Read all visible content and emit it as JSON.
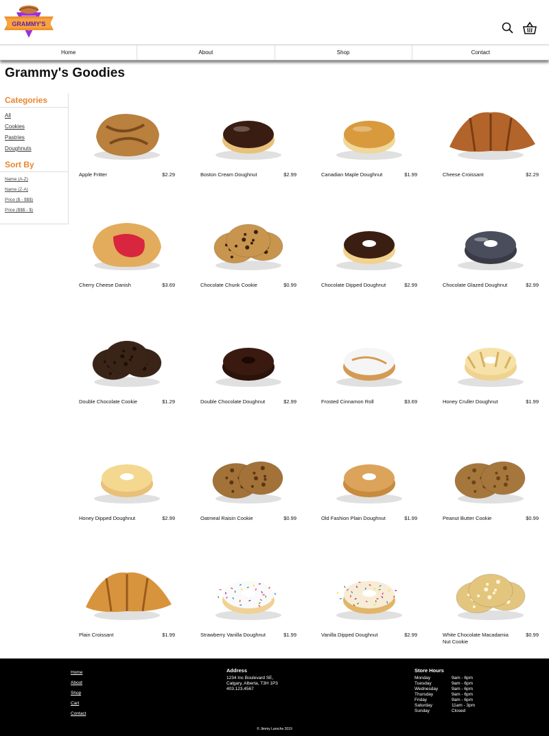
{
  "brand": {
    "logo_text": "GRAMMY'S",
    "orange": "#f0922b",
    "purple": "#8e2ad6"
  },
  "header": {
    "icons": [
      "search-icon",
      "cart-icon"
    ]
  },
  "nav": [
    "Home",
    "About",
    "Shop",
    "Contact"
  ],
  "page_title": "Grammy's Goodies",
  "sidebar": {
    "categories_heading": "Categories",
    "categories": [
      "All",
      "Cookies",
      "Pastries",
      "Doughnuts"
    ],
    "sort_heading": "Sort By",
    "sort_options": [
      "Name (A-Z)",
      "Name (Z-A)",
      "Price ($ - $$$)",
      "Price ($$$ - $)"
    ]
  },
  "products": [
    {
      "name": "Apple Fritter",
      "price": "$2.29",
      "icon": "fritter"
    },
    {
      "name": "Boston Cream Doughnut",
      "price": "$2.99",
      "icon": "boston"
    },
    {
      "name": "Canadian Maple Doughnut",
      "price": "$1.99",
      "icon": "maple"
    },
    {
      "name": "Cheese Croissant",
      "price": "$2.29",
      "icon": "croissant-dark"
    },
    {
      "name": "Cherry Cheese Danish",
      "price": "$3.69",
      "icon": "danish"
    },
    {
      "name": "Chocolate Chunk Cookie",
      "price": "$0.99",
      "icon": "cookie-chunk"
    },
    {
      "name": "Chocolate Dipped Doughnut",
      "price": "$2.99",
      "icon": "donut-choc-dip"
    },
    {
      "name": "Chocolate Glazed Doughnut",
      "price": "$2.99",
      "icon": "donut-choc-glazed"
    },
    {
      "name": "Double Chocolate Cookie",
      "price": "$1.29",
      "icon": "cookie-double-choc"
    },
    {
      "name": "Double Chocolate Doughnut",
      "price": "$2.99",
      "icon": "donut-double-choc"
    },
    {
      "name": "Frosted Cinnamon Roll",
      "price": "$3.69",
      "icon": "cinnamon-roll"
    },
    {
      "name": "Honey Cruller Doughnut",
      "price": "$1.99",
      "icon": "cruller"
    },
    {
      "name": "Honey Dipped Doughnut",
      "price": "$2.99",
      "icon": "donut-honey"
    },
    {
      "name": "Oatmeal Raisin Cookie",
      "price": "$0.99",
      "icon": "cookie-oatmeal"
    },
    {
      "name": "Old Fashion Plain Doughnut",
      "price": "$1.99",
      "icon": "donut-plain"
    },
    {
      "name": "Peanut Butter Cookie",
      "price": "$0.99",
      "icon": "cookie-pb"
    },
    {
      "name": "Plain Croissant",
      "price": "$1.99",
      "icon": "croissant"
    },
    {
      "name": "Strawberry Vanilla Doughnut",
      "price": "$1.99",
      "icon": "donut-sprinkle-white"
    },
    {
      "name": "Vanilla Dipped Doughnut",
      "price": "$2.99",
      "icon": "donut-sprinkle-vanilla"
    },
    {
      "name": "White Chocolate Macadamia Nut Cookie",
      "price": "$0.99",
      "icon": "cookie-white-choc"
    }
  ],
  "footer": {
    "links": [
      "Home",
      "About",
      "Shop",
      "Cart",
      "Contact"
    ],
    "address_heading": "Address",
    "address_lines": [
      "1234 Inc Boulevard SE,",
      "Calgary, Alberta, T3H 1P3",
      "403.123.4567"
    ],
    "hours_heading": "Store Hours",
    "hours": [
      {
        "day": "Monday",
        "time": "9am - 6pm"
      },
      {
        "day": "Tuesday",
        "time": "9am - 6pm"
      },
      {
        "day": "Wednesday",
        "time": "9am - 6pm"
      },
      {
        "day": "Thursday",
        "time": "9am - 6pm"
      },
      {
        "day": "Friday",
        "time": "9am - 6pm"
      },
      {
        "day": "Saturday",
        "time": "11am - 3pm"
      },
      {
        "day": "Sunday",
        "time": "Closed"
      }
    ],
    "copyright": "© Jimmy Laroche 2019"
  }
}
